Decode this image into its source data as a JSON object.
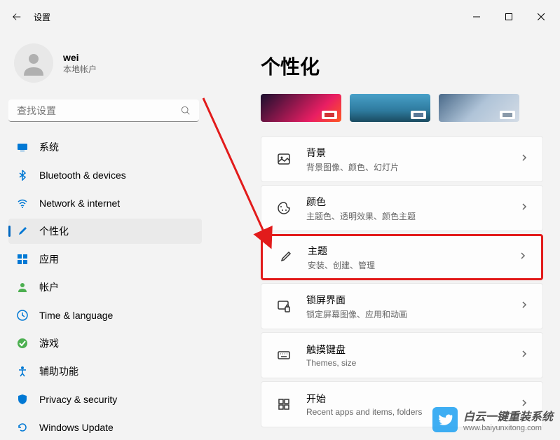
{
  "window": {
    "title": "设置"
  },
  "user": {
    "name": "wei",
    "account_type": "本地帐户"
  },
  "search": {
    "placeholder": "查找设置"
  },
  "nav": [
    {
      "label": "系统",
      "icon": "system"
    },
    {
      "label": "Bluetooth & devices",
      "icon": "bluetooth"
    },
    {
      "label": "Network & internet",
      "icon": "network"
    },
    {
      "label": "个性化",
      "icon": "personalize",
      "active": true
    },
    {
      "label": "应用",
      "icon": "apps"
    },
    {
      "label": "帐户",
      "icon": "account"
    },
    {
      "label": "Time & language",
      "icon": "time"
    },
    {
      "label": "游戏",
      "icon": "gaming"
    },
    {
      "label": "辅助功能",
      "icon": "accessibility"
    },
    {
      "label": "Privacy & security",
      "icon": "privacy"
    },
    {
      "label": "Windows Update",
      "icon": "update"
    }
  ],
  "page": {
    "title": "个性化"
  },
  "settings": [
    {
      "title": "背景",
      "desc": "背景图像、颜色、幻灯片",
      "icon": "background"
    },
    {
      "title": "颜色",
      "desc": "主题色、透明效果、颜色主题",
      "icon": "colors"
    },
    {
      "title": "主题",
      "desc": "安装、创建、管理",
      "icon": "themes",
      "highlighted": true
    },
    {
      "title": "锁屏界面",
      "desc": "锁定屏幕图像、应用和动画",
      "icon": "lockscreen"
    },
    {
      "title": "触摸键盘",
      "desc": "Themes, size",
      "icon": "keyboard"
    },
    {
      "title": "开始",
      "desc": "Recent apps and items, folders",
      "icon": "start"
    }
  ],
  "watermark": {
    "title": "白云一键重装系统",
    "url": "www.baiyunxitong.com"
  }
}
